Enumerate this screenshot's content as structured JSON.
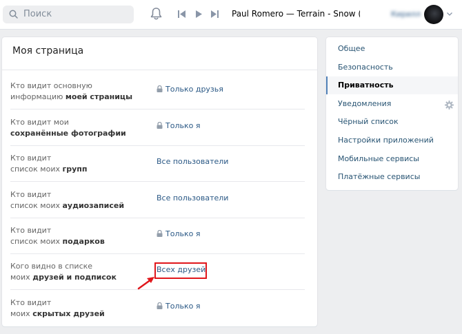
{
  "header": {
    "search_placeholder": "Поиск",
    "track_title": "Paul Romero — Terrain - Snow (Heroe...",
    "username": "Кирилл"
  },
  "card": {
    "title": "Моя страница",
    "rows": [
      {
        "q_line1": "Кто видит основную",
        "q_line2_plain": "информацию ",
        "q_line2_bold": "моей страницы",
        "value": "Только друзья",
        "locked": true
      },
      {
        "q_line1": "Кто видит мои",
        "q_line2_plain": "",
        "q_line2_bold": "сохранённые фотографии",
        "value": "Только я",
        "locked": true
      },
      {
        "q_line1": "Кто видит",
        "q_line2_plain": "список моих ",
        "q_line2_bold": "групп",
        "value": "Все пользователи",
        "locked": false
      },
      {
        "q_line1": "Кто видит",
        "q_line2_plain": "список моих ",
        "q_line2_bold": "аудиозаписей",
        "value": "Все пользователи",
        "locked": false
      },
      {
        "q_line1": "Кто видит",
        "q_line2_plain": "список моих ",
        "q_line2_bold": "подарков",
        "value": "Только я",
        "locked": true
      },
      {
        "q_line1": "Кого видно в списке",
        "q_line2_plain": "моих ",
        "q_line2_bold": "друзей и подписок",
        "value": "Всех друзей",
        "locked": false
      },
      {
        "q_line1": "Кто видит",
        "q_line2_plain": "моих ",
        "q_line2_bold": "скрытых друзей",
        "value": "Только я",
        "locked": true
      }
    ]
  },
  "menu": {
    "items": [
      {
        "label": "Общее"
      },
      {
        "label": "Безопасность"
      },
      {
        "label": "Приватность"
      },
      {
        "label": "Уведомления"
      },
      {
        "label": "Чёрный список"
      },
      {
        "label": "Настройки приложений"
      },
      {
        "label": "Мобильные сервисы"
      },
      {
        "label": "Платёжные сервисы"
      }
    ],
    "active_label": "Приватность"
  },
  "colors": {
    "accent": "#5181b8",
    "link": "#2a5885",
    "highlight": "#e0161b",
    "page_bg": "#edeef0"
  },
  "icons": [
    "search-icon",
    "bell-icon",
    "previous-track-icon",
    "play-icon",
    "next-track-icon",
    "lock-icon",
    "gear-icon",
    "chevron-down-icon",
    "arrow-icon"
  ]
}
